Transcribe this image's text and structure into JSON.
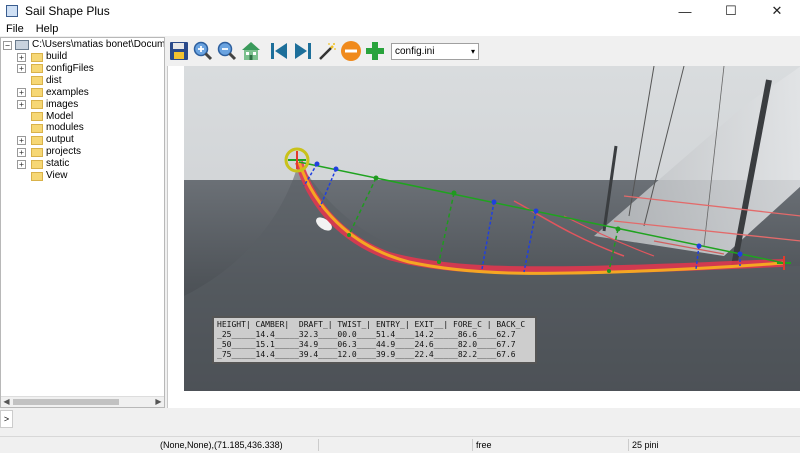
{
  "window": {
    "title": "Sail Shape Plus",
    "controls": [
      "—",
      "☐",
      "✕"
    ]
  },
  "menu": {
    "items": [
      "File",
      "Help"
    ]
  },
  "tree": {
    "root": {
      "label": "C:\\Users\\matias bonet\\Documents\\Or",
      "expander": "−"
    },
    "items": [
      {
        "label": "build",
        "expander": "+"
      },
      {
        "label": "configFiles",
        "expander": "+"
      },
      {
        "label": "dist",
        "expander": ""
      },
      {
        "label": "examples",
        "expander": "+"
      },
      {
        "label": "images",
        "expander": "+"
      },
      {
        "label": "Model",
        "expander": ""
      },
      {
        "label": "modules",
        "expander": ""
      },
      {
        "label": "output",
        "expander": "+"
      },
      {
        "label": "projects",
        "expander": "+"
      },
      {
        "label": "static",
        "expander": "+"
      },
      {
        "label": "View",
        "expander": ""
      }
    ]
  },
  "toolbar": {
    "icons": [
      "save-icon",
      "zoom-in-icon",
      "zoom-out-icon",
      "home-icon",
      "previous-icon",
      "next-icon",
      "magic-wand-icon",
      "remove-icon",
      "add-icon"
    ],
    "config_value": "config.ini"
  },
  "table": {
    "header": "HEIGHT| CAMBER|  DRAFT_| TWIST_| ENTRY_| EXIT__| FORE_C | BACK_C",
    "rows": [
      "_25_____14.4_____32.3____00.0____51.4____14.2_____86.6____62.7",
      "_50_____15.1_____34.9____06.3____44.9____24.6_____82.0____67.7",
      "_75_____14.4_____39.4____12.0____39.9____22.4_____82.2____67.6"
    ]
  },
  "bottom": {
    "expand_label": ">"
  },
  "status": {
    "coords": "(None,None),(71.185,436.338)",
    "mode": "free",
    "points": "25 pini"
  },
  "colors": {
    "chord_line": "#1fa31f",
    "camber_lines_blue": "#1f3fe0",
    "camber_lines_green": "#1f9a1f",
    "curve_orange": "#f5a623",
    "curve_red": "#e8354d",
    "target_yellow": "#c9c21a"
  }
}
